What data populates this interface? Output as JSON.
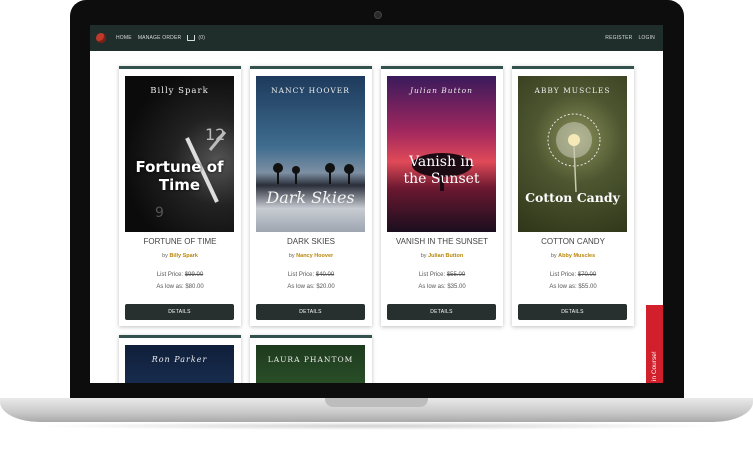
{
  "nav": {
    "home": "HOME",
    "manage_order": "MANAGE ORDER",
    "cart_count": "(0)",
    "register": "REGISTER",
    "login": "LOGIN"
  },
  "books": [
    {
      "cover_author": "Billy Spark",
      "cover_title": "Fortune of Time",
      "title": "FORTUNE OF TIME",
      "by": "by",
      "author": "Billy Spark",
      "list_label": "List Price:",
      "list_price": "$99.00",
      "low_label": "As low as:",
      "low_price": "$80.00",
      "details": "DETAILS"
    },
    {
      "cover_author": "NANCY HOOVER",
      "cover_title": "Dark Skies",
      "title": "DARK SKIES",
      "by": "by",
      "author": "Nancy Hoover",
      "list_label": "List Price:",
      "list_price": "$40.00",
      "low_label": "As low as:",
      "low_price": "$20.00",
      "details": "DETAILS"
    },
    {
      "cover_author": "Julian Button",
      "cover_title": "Vanish in the Sunset",
      "title": "VANISH IN THE SUNSET",
      "by": "by",
      "author": "Julian Button",
      "list_label": "List Price:",
      "list_price": "$55.00",
      "low_label": "As low as:",
      "low_price": "$35.00",
      "details": "DETAILS"
    },
    {
      "cover_author": "ABBY MUSCLES",
      "cover_title": "Cotton Candy",
      "title": "COTTON CANDY",
      "by": "by",
      "author": "Abby Muscles",
      "list_label": "List Price:",
      "list_price": "$70.00",
      "low_label": "As low as:",
      "low_price": "$55.00",
      "details": "DETAILS"
    },
    {
      "cover_author": "Ron Parker"
    },
    {
      "cover_author": "LAURA PHANTOM"
    }
  ],
  "side_tab": "in Course!"
}
